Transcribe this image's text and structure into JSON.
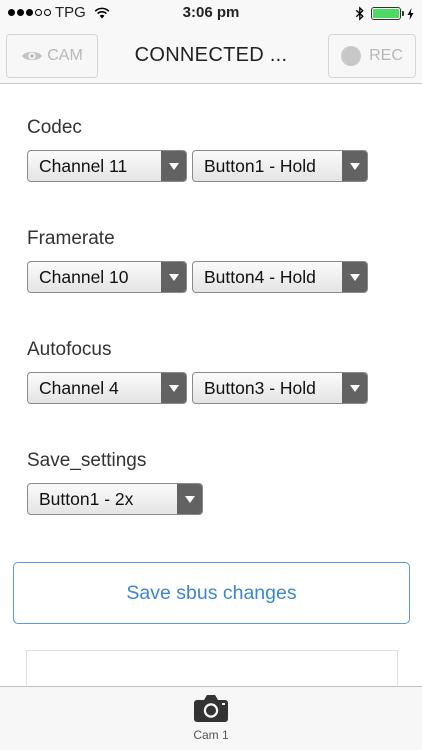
{
  "status_bar": {
    "carrier": "TPG",
    "time": "3:06 pm",
    "signal_bars_filled": 3,
    "signal_bars_total": 5,
    "battery_level": 1.0,
    "icons": [
      "wifi-icon",
      "bluetooth-icon",
      "battery-icon",
      "charging-bolt-icon"
    ]
  },
  "nav": {
    "title": "CONNECTED ...",
    "cam_label": "CAM",
    "rec_label": "REC",
    "cam_icon": "eye-icon",
    "rec_icon": "record-dot-icon"
  },
  "settings": [
    {
      "label": "Codec",
      "channel": "Channel 11",
      "button": "Button1 - Hold"
    },
    {
      "label": "Framerate",
      "channel": "Channel 10",
      "button": "Button4 - Hold"
    },
    {
      "label": "Autofocus",
      "channel": "Channel 4",
      "button": "Button3 - Hold"
    },
    {
      "label": "Save_settings",
      "button": "Button1 - 2x"
    }
  ],
  "save_button_label": "Save sbus changes",
  "tab_bar": {
    "items": [
      {
        "label": "Cam 1",
        "icon": "camera-icon"
      }
    ]
  },
  "colors": {
    "accent_blue": "#3d87d0",
    "battery_green": "#4cd964",
    "select_arrow_bg": "#626262"
  }
}
